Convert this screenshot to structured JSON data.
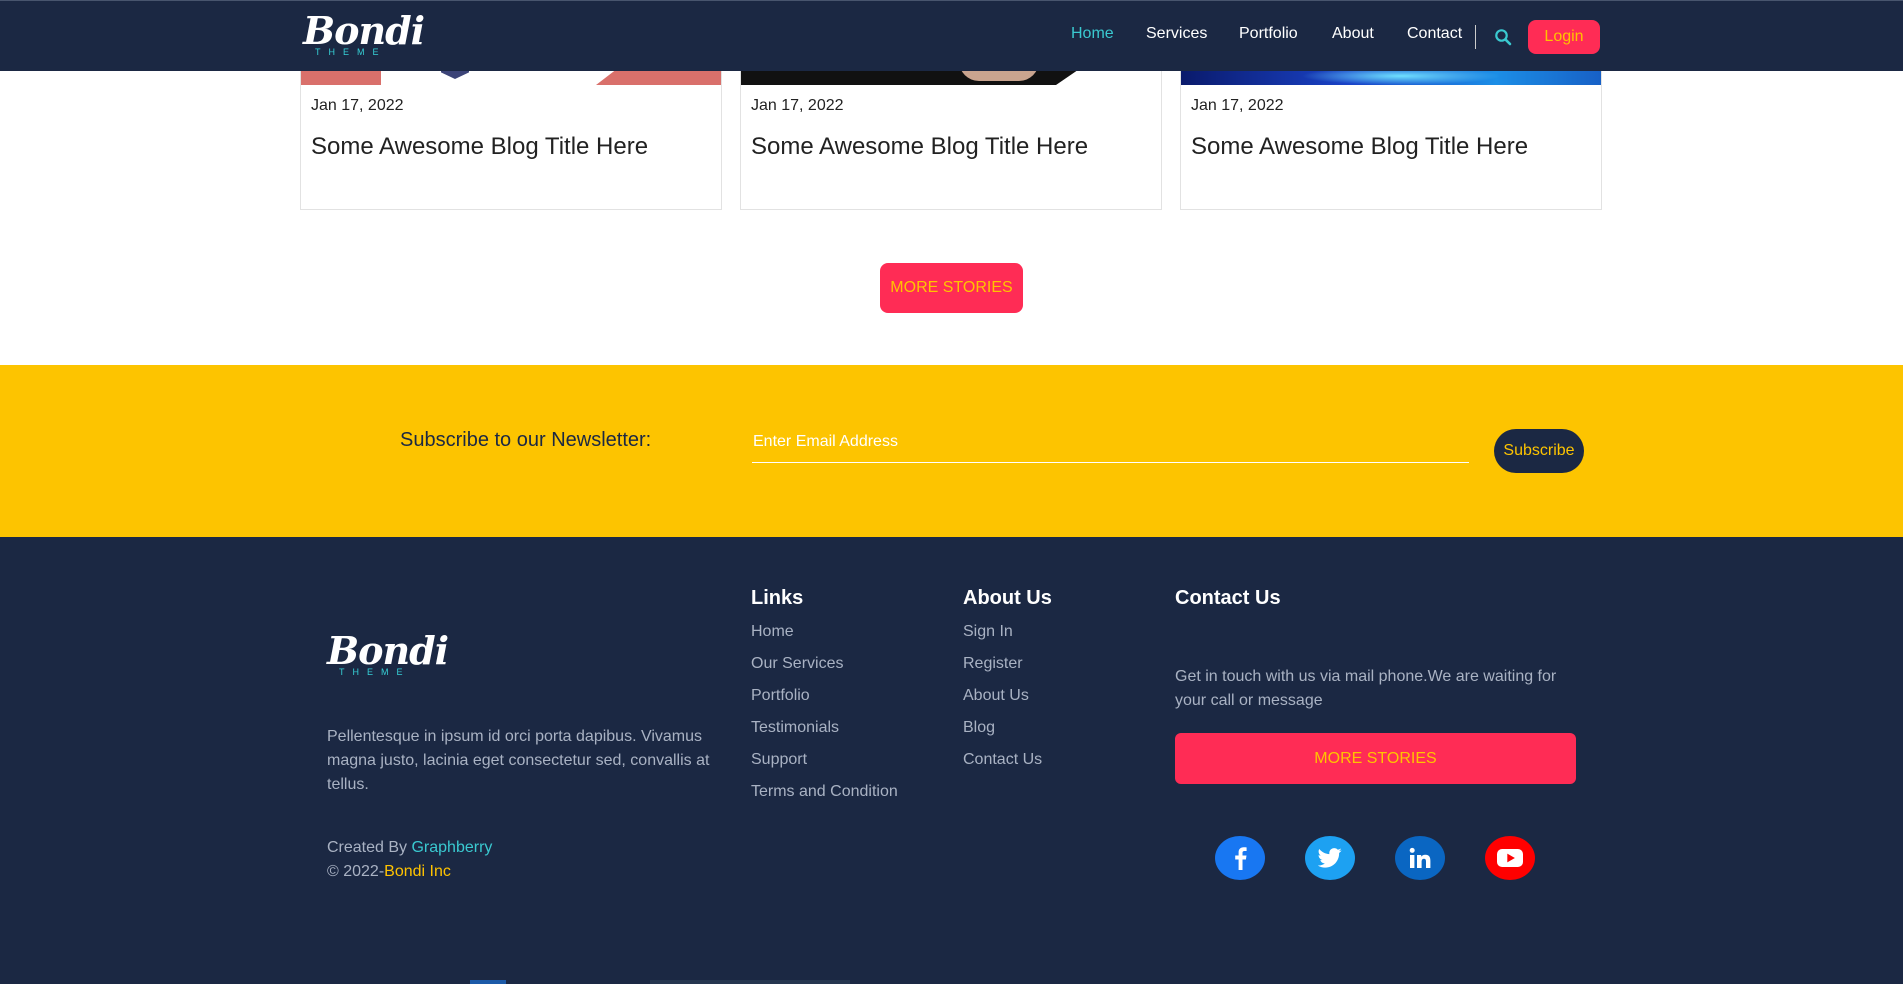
{
  "nav": {
    "logo": {
      "script": "Bondi",
      "sub": "THEME"
    },
    "items": [
      {
        "label": "Home",
        "active": true
      },
      {
        "label": "Services"
      },
      {
        "label": "Portfolio"
      },
      {
        "label": "About"
      },
      {
        "label": "Contact"
      }
    ],
    "search_icon": "search-icon",
    "login_label": "Login"
  },
  "blog": {
    "cards": [
      {
        "date": "Jan 17, 2022",
        "title": "Some Awesome Blog Title Here"
      },
      {
        "date": "Jan 17, 2022",
        "title": "Some Awesome Blog Title Here"
      },
      {
        "date": "Jan 17, 2022",
        "title": "Some Awesome Blog Title Here"
      }
    ],
    "more_label": "MORE STORIES"
  },
  "newsletter": {
    "label": "Subscribe to our Newsletter:",
    "placeholder": "Enter Email Address",
    "button_label": "Subscribe"
  },
  "footer": {
    "logo": {
      "script": "Bondi",
      "sub": "THEME"
    },
    "description": "Pellentesque in ipsum id orci porta dapibus. Vivamus magna justo, lacinia eget consectetur sed, convallis at tellus.",
    "created_prefix": "Created By ",
    "created_by": "Graphberry",
    "copyright_prefix": "© 2022-",
    "copyright_name": "Bondi Inc",
    "links": {
      "heading": "Links",
      "items": [
        "Home",
        "Our Services",
        "Portfolio",
        "Testimonials",
        "Support",
        "Terms and Condition"
      ]
    },
    "about": {
      "heading": "About Us",
      "items": [
        "Sign In",
        "Register",
        "About Us",
        "Blog",
        "Contact Us"
      ]
    },
    "contact": {
      "heading": "Contact Us",
      "text": "Get in touch with us via mail phone.We are waiting for your call or message",
      "button_label": "MORE STORIES"
    },
    "social": [
      {
        "icon": "facebook-icon",
        "color": "#1877f2"
      },
      {
        "icon": "twitter-icon",
        "color": "#1da1f2"
      },
      {
        "icon": "linkedin-icon",
        "color": "#0a66c2"
      },
      {
        "icon": "youtube-icon",
        "color": "#ff0000"
      }
    ]
  },
  "colors": {
    "navy": "#1b2843",
    "accent_pink": "#ff2c55",
    "accent_yellow": "#fdc400",
    "accent_cyan": "#3ac9d0"
  }
}
